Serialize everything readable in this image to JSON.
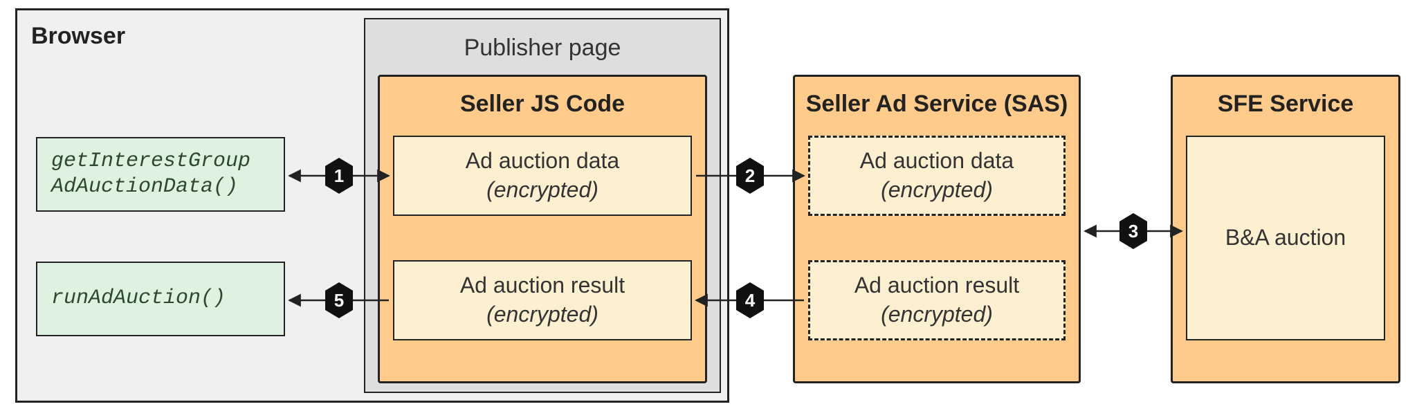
{
  "browser": {
    "label": "Browser"
  },
  "publisher_page": {
    "label": "Publisher page"
  },
  "seller_js": {
    "title": "Seller JS Code",
    "data_box": {
      "line1": "Ad auction data",
      "line2": "(encrypted)"
    },
    "result_box": {
      "line1": "Ad auction result",
      "line2": "(encrypted)"
    }
  },
  "sas": {
    "title": "Seller Ad Service (SAS)",
    "data_box": {
      "line1": "Ad auction data",
      "line2": "(encrypted)"
    },
    "result_box": {
      "line1": "Ad auction result",
      "line2": "(encrypted)"
    }
  },
  "sfe": {
    "title": "SFE Service",
    "body": "B&A auction"
  },
  "api": {
    "get_data": "getInterestGroup\nAdAuctionData()",
    "run": "runAdAuction()"
  },
  "steps": {
    "s1": "1",
    "s2": "2",
    "s3": "3",
    "s4": "4",
    "s5": "5"
  }
}
